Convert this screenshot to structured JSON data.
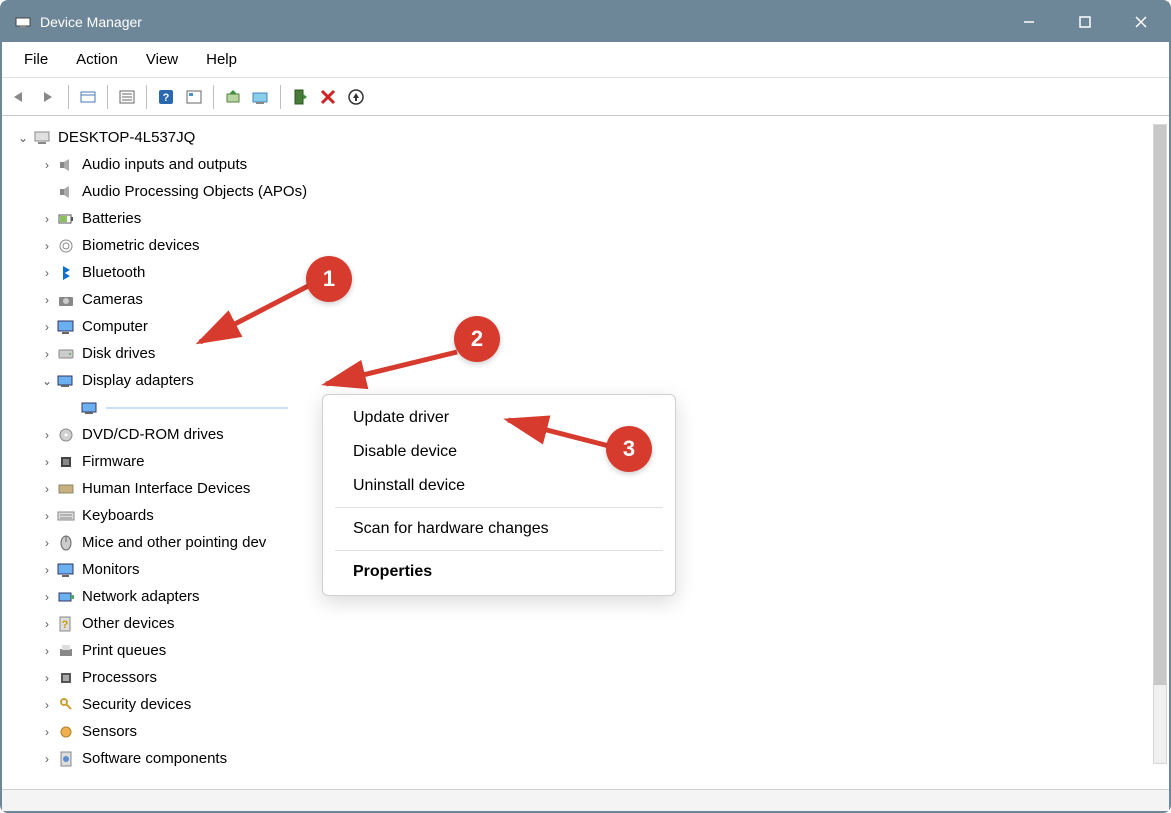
{
  "window": {
    "title": "Device Manager"
  },
  "menu": {
    "file": "File",
    "action": "Action",
    "view": "View",
    "help": "Help"
  },
  "toolbar_icons": [
    "back",
    "forward",
    "sep",
    "show-hidden",
    "details",
    "sep",
    "help",
    "properties",
    "sep",
    "update-driver",
    "scan-hardware",
    "sep",
    "enable-device",
    "disable-device",
    "uninstall-device"
  ],
  "computer_name": "DESKTOP-4L537JQ",
  "categories": [
    {
      "label": "Audio inputs and outputs",
      "icon": "speaker-icon",
      "expandable": true
    },
    {
      "label": "Audio Processing Objects (APOs)",
      "icon": "speaker-icon",
      "expandable": false
    },
    {
      "label": "Batteries",
      "icon": "battery-icon",
      "expandable": true
    },
    {
      "label": "Biometric devices",
      "icon": "fingerprint-icon",
      "expandable": true
    },
    {
      "label": "Bluetooth",
      "icon": "bluetooth-icon",
      "expandable": true
    },
    {
      "label": "Cameras",
      "icon": "camera-icon",
      "expandable": true
    },
    {
      "label": "Computer",
      "icon": "monitor-icon",
      "expandable": true
    },
    {
      "label": "Disk drives",
      "icon": "disk-icon",
      "expandable": true
    }
  ],
  "display_adapters": {
    "label": "Display adapters",
    "expanded": true,
    "child": {
      "label": " ",
      "selected": true
    }
  },
  "categories_after": [
    {
      "label": "DVD/CD-ROM drives",
      "icon": "dvd-icon",
      "expandable": true
    },
    {
      "label": "Firmware",
      "icon": "chip-icon",
      "expandable": true
    },
    {
      "label": "Human Interface Devices",
      "icon": "hid-icon",
      "expandable": true
    },
    {
      "label": "Keyboards",
      "icon": "keyboard-icon",
      "expandable": true
    },
    {
      "label": "Mice and other pointing dev",
      "icon": "mouse-icon",
      "expandable": true
    },
    {
      "label": "Monitors",
      "icon": "monitor-icon",
      "expandable": true
    },
    {
      "label": "Network adapters",
      "icon": "network-icon",
      "expandable": true
    },
    {
      "label": "Other devices",
      "icon": "question-icon",
      "expandable": true
    },
    {
      "label": "Print queues",
      "icon": "printer-icon",
      "expandable": true
    },
    {
      "label": "Processors",
      "icon": "cpu-icon",
      "expandable": true
    },
    {
      "label": "Security devices",
      "icon": "key-icon",
      "expandable": true
    },
    {
      "label": "Sensors",
      "icon": "sensor-icon",
      "expandable": true
    },
    {
      "label": "Software components",
      "icon": "software-icon",
      "expandable": true
    }
  ],
  "context_menu": {
    "update": "Update driver",
    "disable": "Disable device",
    "uninstall": "Uninstall device",
    "scan": "Scan for hardware changes",
    "properties": "Properties"
  },
  "annotations": {
    "step1": "1",
    "step2": "2",
    "step3": "3"
  }
}
